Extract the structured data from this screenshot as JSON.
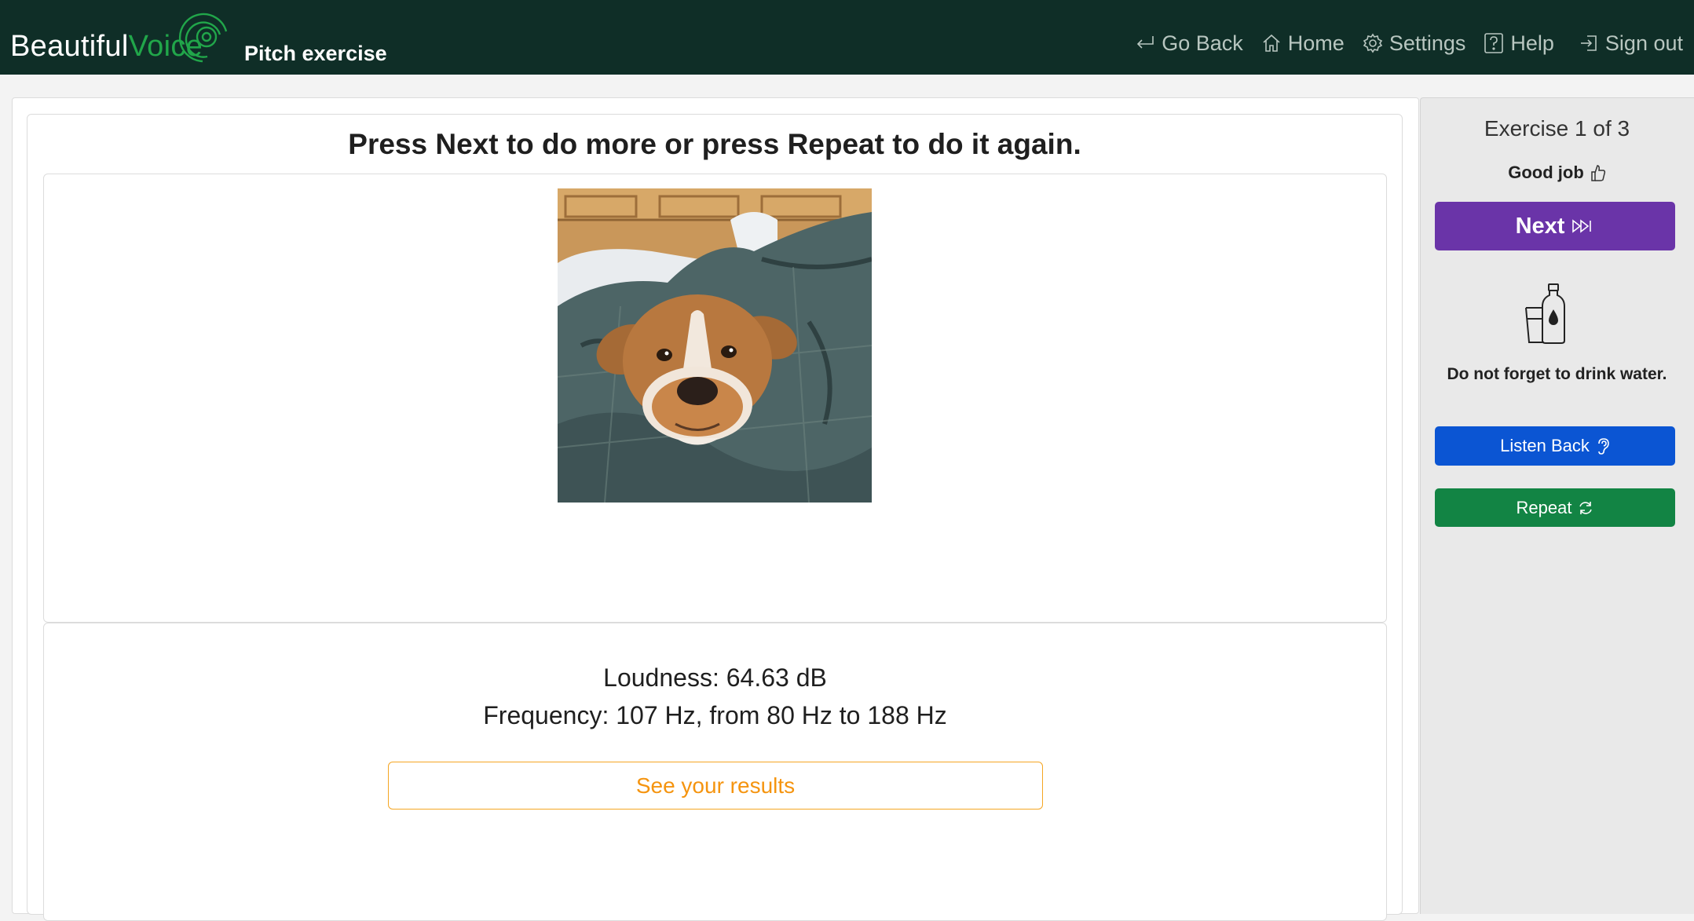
{
  "header": {
    "brand_part1": "Beautiful",
    "brand_part2": "Voice",
    "page_title": "Pitch exercise",
    "nav": [
      {
        "label": "Go Back",
        "icon": "return-arrow-icon"
      },
      {
        "label": "Home",
        "icon": "home-icon"
      },
      {
        "label": "Settings",
        "icon": "gear-icon"
      },
      {
        "label": "Help",
        "icon": "question-box-icon"
      },
      {
        "label": "Sign out",
        "icon": "sign-out-icon"
      }
    ]
  },
  "main": {
    "instruction": "Press Next to do more or press Repeat to do it again.",
    "image": "dog-under-blanket-photo",
    "loudness": "Loudness: 64.63 dB",
    "frequency": "Frequency: 107 Hz, from 80 Hz to 188 Hz",
    "results_button": "See your results"
  },
  "sidebar": {
    "exercise_counter": "Exercise 1 of 3",
    "feedback": "Good job",
    "next_button": "Next",
    "water_reminder": "Do not forget to drink water.",
    "listen_back_button": "Listen Back",
    "repeat_button": "Repeat"
  },
  "colors": {
    "header_bg": "#0f2e27",
    "brand_green": "#21a64a",
    "next_purple": "#6a34a8",
    "listen_blue": "#0b55d3",
    "repeat_green": "#128444",
    "results_orange": "#f5a623"
  }
}
